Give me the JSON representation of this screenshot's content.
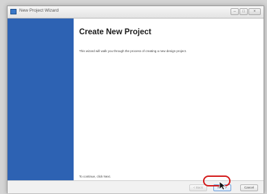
{
  "window": {
    "title": "New Project Wizard",
    "minimize_label": "–",
    "maximize_label": "□",
    "close_label": "×"
  },
  "page": {
    "heading": "Create New Project",
    "description": "This wizard will walk you through the process of creating a new design project.",
    "continue_hint": "To continue, click Next."
  },
  "buttons": {
    "back": "< Back",
    "next": "Next >",
    "cancel": "Cancel"
  },
  "colors": {
    "sidebar": "#2d62b3",
    "highlight": "#d31818"
  }
}
